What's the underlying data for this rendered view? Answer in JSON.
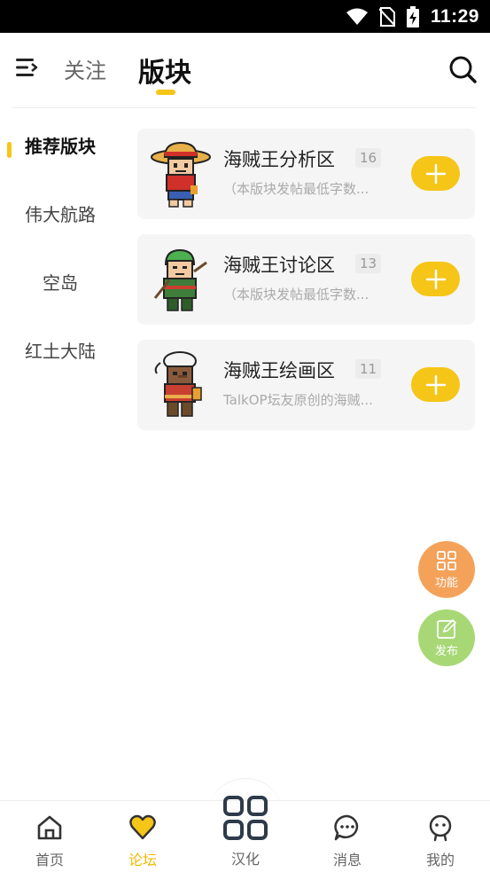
{
  "status_bar": {
    "time": "11:29"
  },
  "header": {
    "tabs": [
      {
        "label": "关注",
        "active": false
      },
      {
        "label": "版块",
        "active": true
      }
    ]
  },
  "sidebar": {
    "items": [
      {
        "label": "推荐版块",
        "active": true
      },
      {
        "label": "伟大航路",
        "active": false
      },
      {
        "label": "空岛",
        "active": false
      },
      {
        "label": "红土大陆",
        "active": false
      }
    ]
  },
  "boards": [
    {
      "title": "海贼王分析区",
      "count": "16",
      "desc": "（本版块发帖最低字数..."
    },
    {
      "title": "海贼王讨论区",
      "count": "13",
      "desc": "（本版块发帖最低字数..."
    },
    {
      "title": "海贼王绘画区",
      "count": "11",
      "desc": "TalkOP坛友原创的海贼..."
    }
  ],
  "fabs": {
    "function_label": "功能",
    "publish_label": "发布"
  },
  "bottom_nav": [
    {
      "label": "首页",
      "icon": "home-icon",
      "active": false
    },
    {
      "label": "论坛",
      "icon": "heart-icon",
      "active": true
    },
    {
      "label": "汉化",
      "icon": "grid-icon",
      "active": false
    },
    {
      "label": "消息",
      "icon": "chat-icon",
      "active": false
    },
    {
      "label": "我的",
      "icon": "profile-icon",
      "active": false
    }
  ],
  "colors": {
    "accent": "#f5c518",
    "fab_function": "#f4a25a",
    "fab_publish": "#a7d875"
  }
}
